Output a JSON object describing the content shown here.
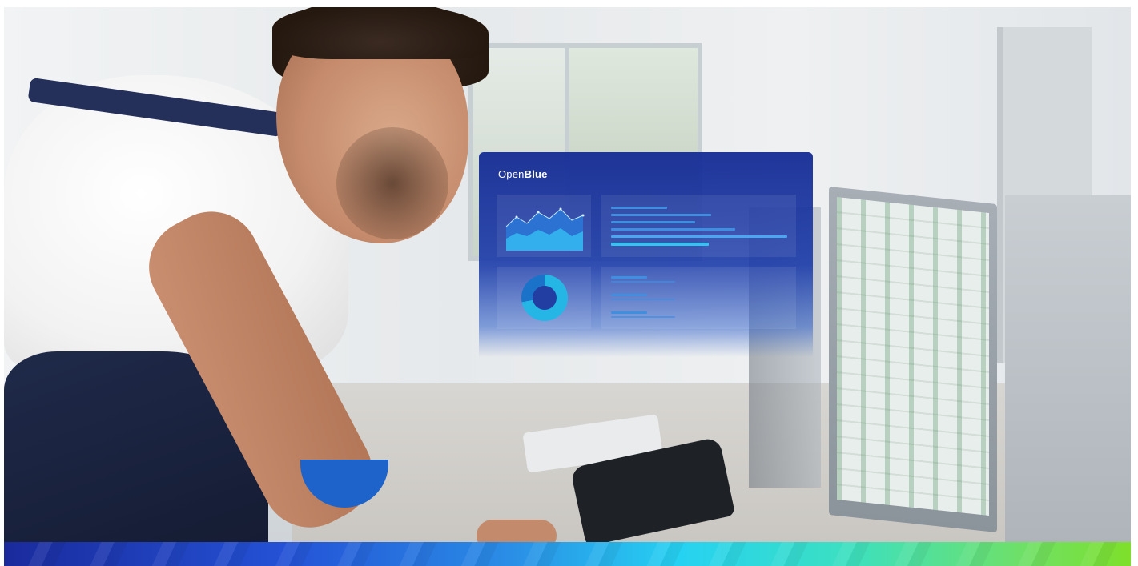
{
  "overlay": {
    "brand_prefix": "Open",
    "brand_bold": "Blue"
  },
  "colors": {
    "panel": "#1a2f9c",
    "stripe_start": "#1a2a9c",
    "stripe_end": "#7ee02a"
  }
}
